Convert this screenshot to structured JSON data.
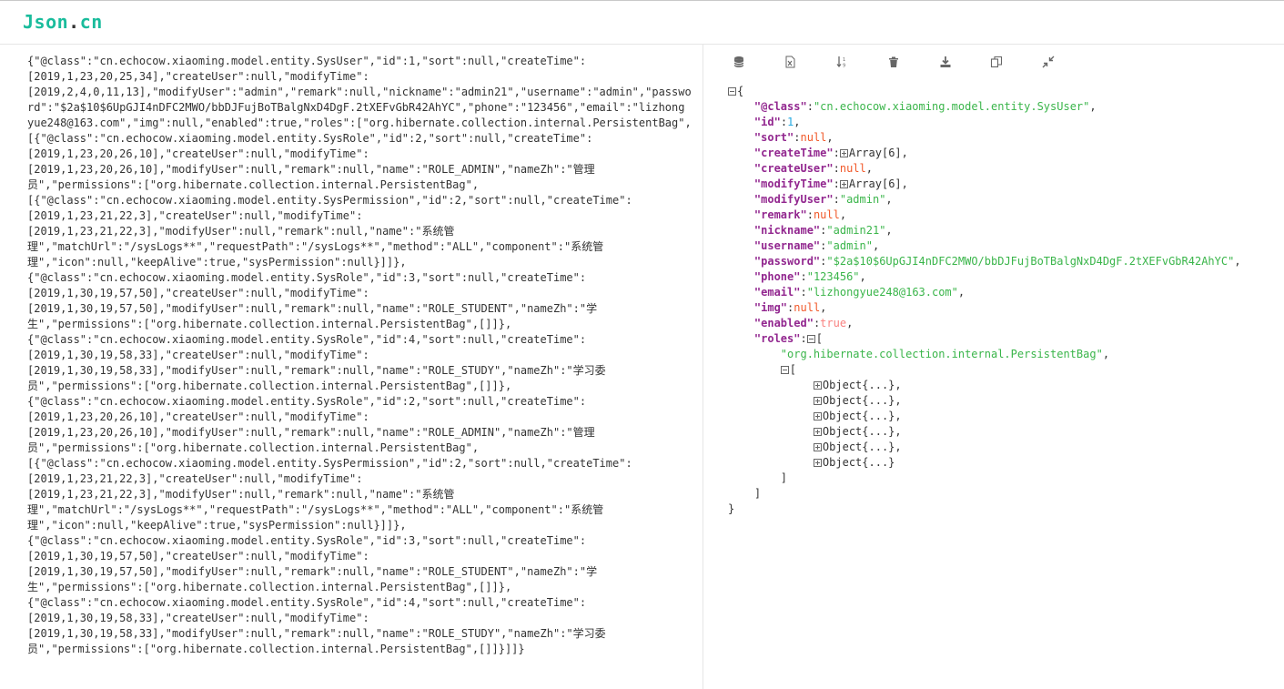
{
  "app": {
    "logo_main": "Json",
    "logo_dot": ".",
    "logo_tld": "cn"
  },
  "raw_lines": [
    "{\"@class\":\"cn.echocow.xiaoming.model.entity.SysUser\",\"id\":1,\"sort\":null,\"createTime\":",
    "[2019,1,23,20,25,34],\"createUser\":null,\"modifyTime\":",
    "[2019,2,4,0,11,13],\"modifyUser\":\"admin\",\"remark\":null,\"nickname\":\"admin21\",\"username\":\"admin\",\"passwo",
    "rd\":\"$2a$10$6UpGJI4nDFC2MWO/bbDJFujBoTBalgNxD4DgF.2tXEFvGbR42AhYC\",\"phone\":\"123456\",\"email\":\"lizhong",
    "yue248@163.com\",\"img\":null,\"enabled\":true,\"roles\":[\"org.hibernate.collection.internal.PersistentBag\",",
    "[{\"@class\":\"cn.echocow.xiaoming.model.entity.SysRole\",\"id\":2,\"sort\":null,\"createTime\":",
    "[2019,1,23,20,26,10],\"createUser\":null,\"modifyTime\":",
    "[2019,1,23,20,26,10],\"modifyUser\":null,\"remark\":null,\"name\":\"ROLE_ADMIN\",\"nameZh\":\"管理",
    "员\",\"permissions\":[\"org.hibernate.collection.internal.PersistentBag\",",
    "[{\"@class\":\"cn.echocow.xiaoming.model.entity.SysPermission\",\"id\":2,\"sort\":null,\"createTime\":",
    "[2019,1,23,21,22,3],\"createUser\":null,\"modifyTime\":",
    "[2019,1,23,21,22,3],\"modifyUser\":null,\"remark\":null,\"name\":\"系统管",
    "理\",\"matchUrl\":\"/sysLogs**\",\"requestPath\":\"/sysLogs**\",\"method\":\"ALL\",\"component\":\"系统管",
    "理\",\"icon\":null,\"keepAlive\":true,\"sysPermission\":null}]]},",
    "{\"@class\":\"cn.echocow.xiaoming.model.entity.SysRole\",\"id\":3,\"sort\":null,\"createTime\":",
    "[2019,1,30,19,57,50],\"createUser\":null,\"modifyTime\":",
    "[2019,1,30,19,57,50],\"modifyUser\":null,\"remark\":null,\"name\":\"ROLE_STUDENT\",\"nameZh\":\"学",
    "生\",\"permissions\":[\"org.hibernate.collection.internal.PersistentBag\",[]]},",
    "{\"@class\":\"cn.echocow.xiaoming.model.entity.SysRole\",\"id\":4,\"sort\":null,\"createTime\":",
    "[2019,1,30,19,58,33],\"createUser\":null,\"modifyTime\":",
    "[2019,1,30,19,58,33],\"modifyUser\":null,\"remark\":null,\"name\":\"ROLE_STUDY\",\"nameZh\":\"学习委",
    "员\",\"permissions\":[\"org.hibernate.collection.internal.PersistentBag\",[]]},",
    "{\"@class\":\"cn.echocow.xiaoming.model.entity.SysRole\",\"id\":2,\"sort\":null,\"createTime\":",
    "[2019,1,23,20,26,10],\"createUser\":null,\"modifyTime\":",
    "[2019,1,23,20,26,10],\"modifyUser\":null,\"remark\":null,\"name\":\"ROLE_ADMIN\",\"nameZh\":\"管理",
    "员\",\"permissions\":[\"org.hibernate.collection.internal.PersistentBag\",",
    "[{\"@class\":\"cn.echocow.xiaoming.model.entity.SysPermission\",\"id\":2,\"sort\":null,\"createTime\":",
    "[2019,1,23,21,22,3],\"createUser\":null,\"modifyTime\":",
    "[2019,1,23,21,22,3],\"modifyUser\":null,\"remark\":null,\"name\":\"系统管",
    "理\",\"matchUrl\":\"/sysLogs**\",\"requestPath\":\"/sysLogs**\",\"method\":\"ALL\",\"component\":\"系统管",
    "理\",\"icon\":null,\"keepAlive\":true,\"sysPermission\":null}]]},",
    "{\"@class\":\"cn.echocow.xiaoming.model.entity.SysRole\",\"id\":3,\"sort\":null,\"createTime\":",
    "[2019,1,30,19,57,50],\"createUser\":null,\"modifyTime\":",
    "[2019,1,30,19,57,50],\"modifyUser\":null,\"remark\":null,\"name\":\"ROLE_STUDENT\",\"nameZh\":\"学",
    "生\",\"permissions\":[\"org.hibernate.collection.internal.PersistentBag\",[]]},",
    "{\"@class\":\"cn.echocow.xiaoming.model.entity.SysRole\",\"id\":4,\"sort\":null,\"createTime\":",
    "[2019,1,30,19,58,33],\"createUser\":null,\"modifyTime\":",
    "[2019,1,30,19,58,33],\"modifyUser\":null,\"remark\":null,\"name\":\"ROLE_STUDY\",\"nameZh\":\"学习委",
    "员\",\"permissions\":[\"org.hibernate.collection.internal.PersistentBag\",[]]}]]}"
  ],
  "toolbar": [
    {
      "name": "database-icon",
      "icon": "database"
    },
    {
      "name": "excel-icon",
      "icon": "excel"
    },
    {
      "name": "sort-icon",
      "icon": "sort"
    },
    {
      "name": "trash-icon",
      "icon": "trash"
    },
    {
      "name": "download-icon",
      "icon": "download"
    },
    {
      "name": "copy-icon",
      "icon": "copy"
    },
    {
      "name": "compress-icon",
      "icon": "compress"
    }
  ],
  "tree": {
    "root_open": "{",
    "root_close": "}",
    "fields": [
      {
        "key": "@class",
        "type": "str",
        "value": "cn.echocow.xiaoming.model.entity.SysUser"
      },
      {
        "key": "id",
        "type": "num",
        "value": "1"
      },
      {
        "key": "sort",
        "type": "nul",
        "value": "null"
      },
      {
        "key": "createTime",
        "type": "collapsed",
        "value": "Array[6]"
      },
      {
        "key": "createUser",
        "type": "nul",
        "value": "null"
      },
      {
        "key": "modifyTime",
        "type": "collapsed",
        "value": "Array[6]"
      },
      {
        "key": "modifyUser",
        "type": "str",
        "value": "admin"
      },
      {
        "key": "remark",
        "type": "nul",
        "value": "null"
      },
      {
        "key": "nickname",
        "type": "str",
        "value": "admin21"
      },
      {
        "key": "username",
        "type": "str",
        "value": "admin"
      },
      {
        "key": "password",
        "type": "str",
        "value": "$2a$10$6UpGJI4nDFC2MWO/bbDJFujBoTBalgNxD4DgF.2tXEFvGbR42AhYC"
      },
      {
        "key": "phone",
        "type": "str",
        "value": "123456"
      },
      {
        "key": "email",
        "type": "str",
        "value": "lizhongyue248@163.com"
      },
      {
        "key": "img",
        "type": "nul",
        "value": "null"
      },
      {
        "key": "enabled",
        "type": "bool",
        "value": "true"
      }
    ],
    "roles_key": "roles",
    "roles_bag": "org.hibernate.collection.internal.PersistentBag",
    "role_objects": [
      "Object{...}",
      "Object{...}",
      "Object{...}",
      "Object{...}",
      "Object{...}",
      "Object{...}"
    ]
  }
}
